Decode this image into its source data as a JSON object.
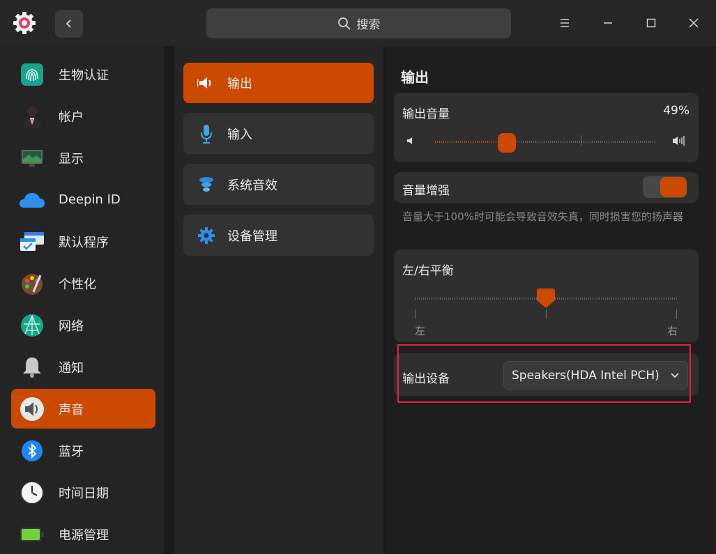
{
  "titlebar": {
    "search_label": "搜索"
  },
  "nav": {
    "items": [
      {
        "label": "生物认证"
      },
      {
        "label": "帐户"
      },
      {
        "label": "显示"
      },
      {
        "label": "Deepin ID"
      },
      {
        "label": "默认程序"
      },
      {
        "label": "个性化"
      },
      {
        "label": "网络"
      },
      {
        "label": "通知"
      },
      {
        "label": "声音"
      },
      {
        "label": "蓝牙"
      },
      {
        "label": "时间日期"
      },
      {
        "label": "电源管理"
      }
    ],
    "active": "声音"
  },
  "subnav": {
    "items": [
      {
        "label": "输出"
      },
      {
        "label": "输入"
      },
      {
        "label": "系统音效"
      },
      {
        "label": "设备管理"
      }
    ],
    "active": "输出"
  },
  "output": {
    "section_title": "输出",
    "volume": {
      "label": "输出音量",
      "value_text": "49%",
      "value": 49
    },
    "boost": {
      "label": "音量增强",
      "enabled": true,
      "hint": "音量大于100%时可能会导致音效失真，同时损害您的扬声器"
    },
    "balance": {
      "label": "左/右平衡",
      "left_label": "左",
      "right_label": "右",
      "value": 0
    },
    "device": {
      "label": "输出设备",
      "selected": "Speakers(HDA Intel PCH)"
    }
  },
  "colors": {
    "accent": "#cc4a00",
    "highlight_box": "#e5214a"
  }
}
